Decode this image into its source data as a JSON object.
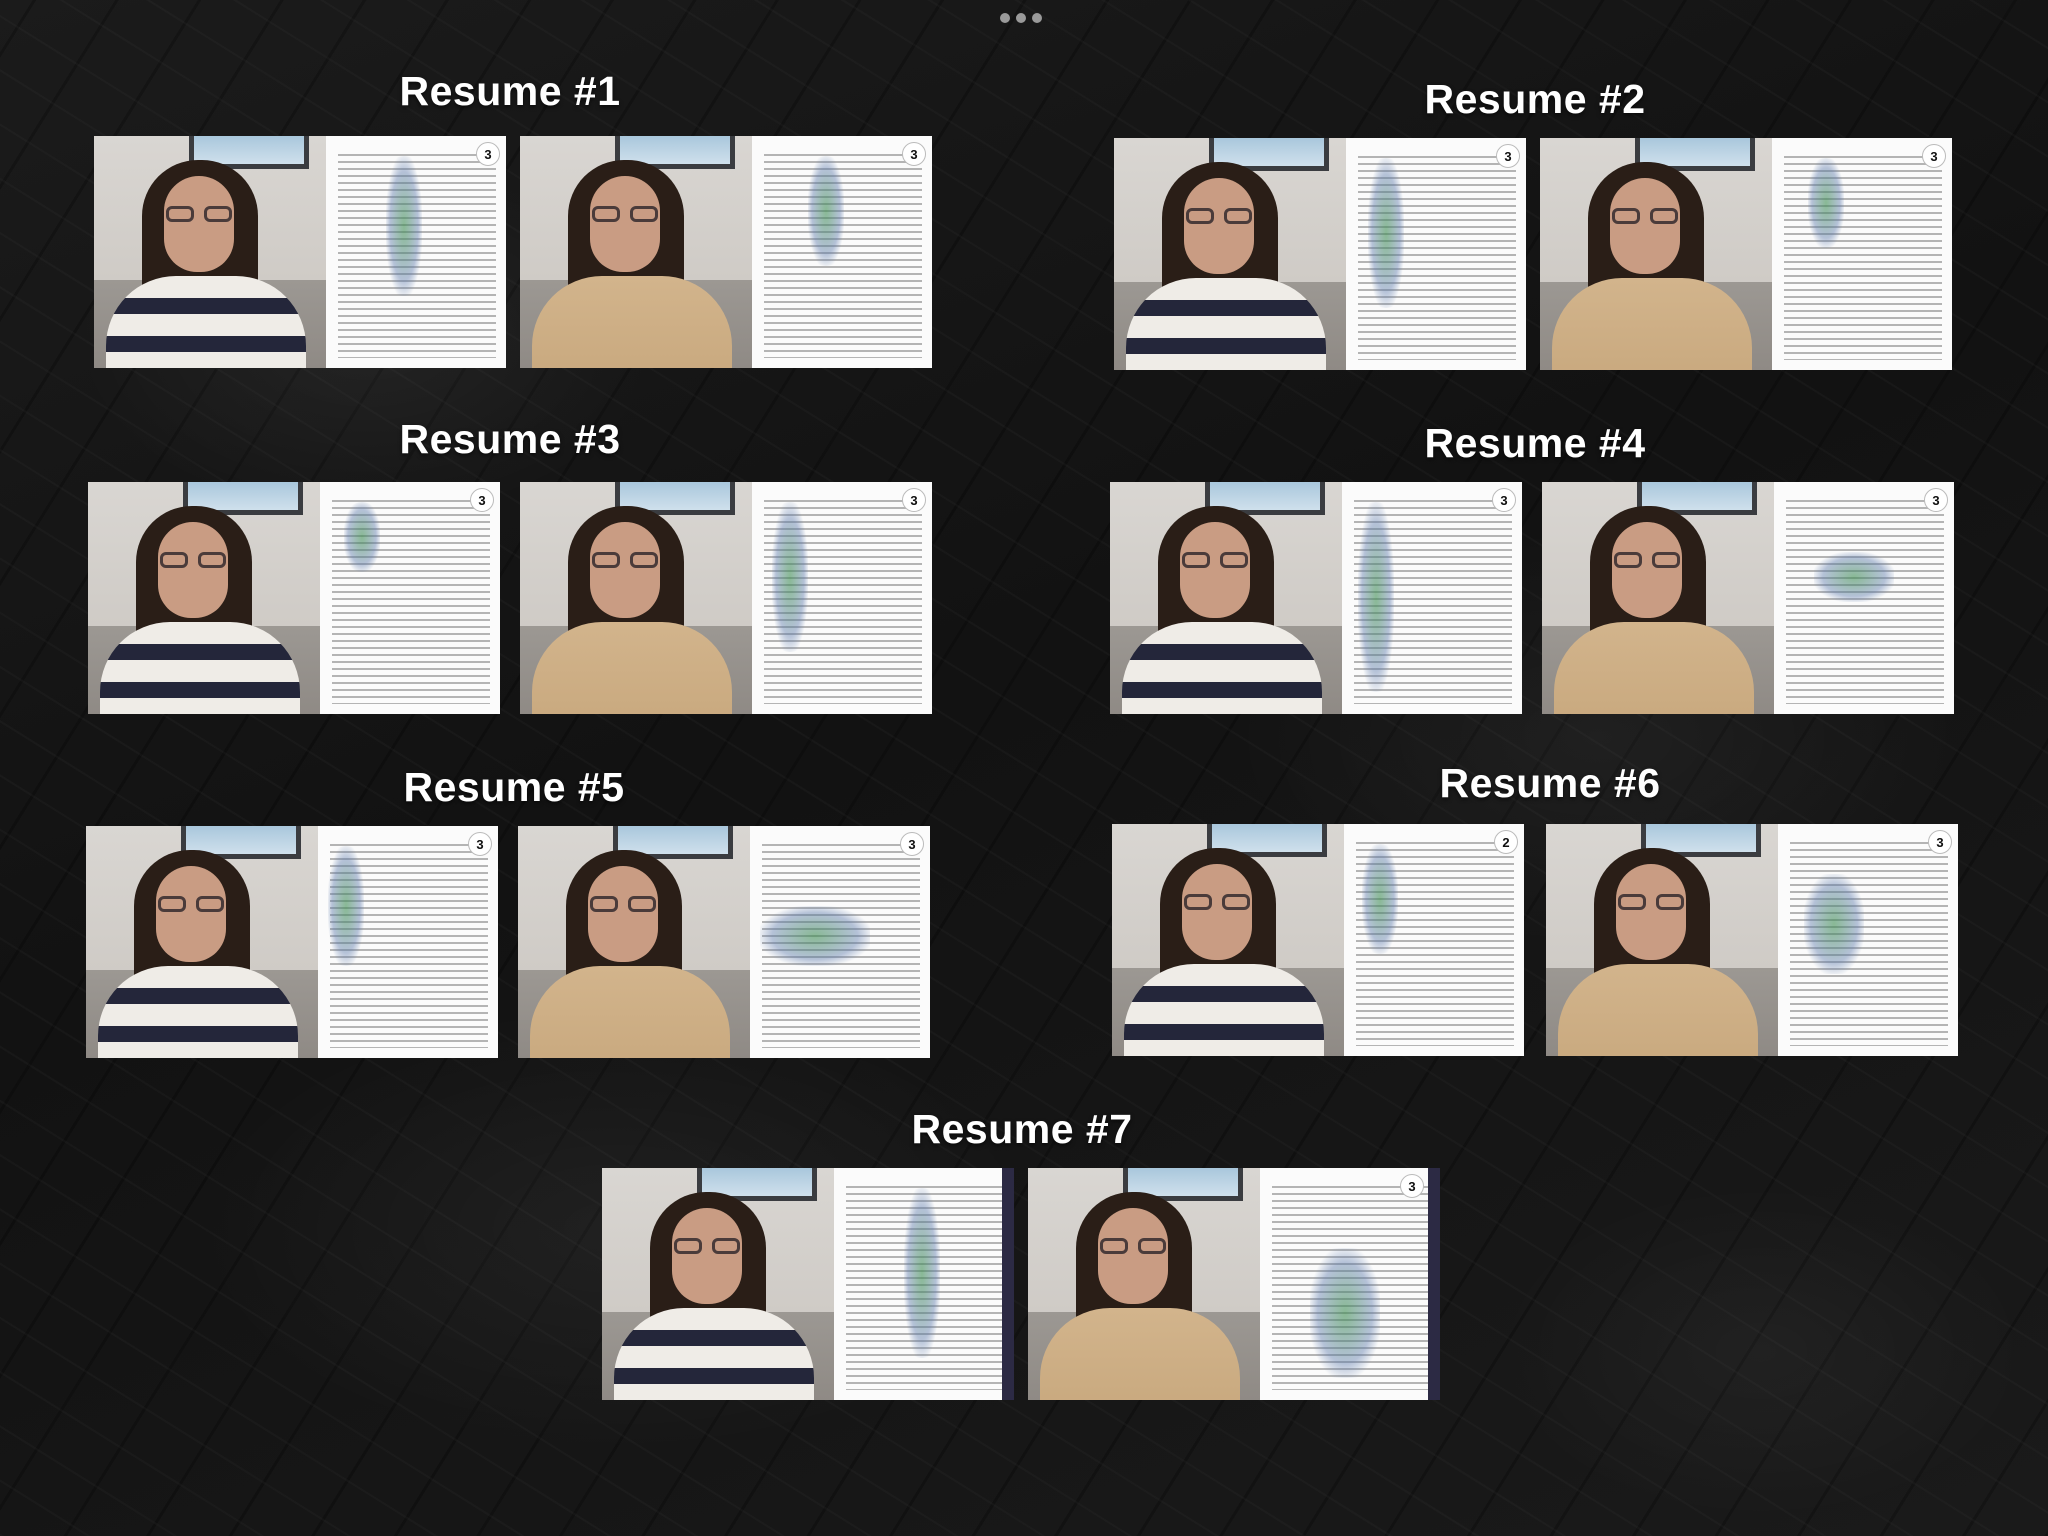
{
  "top_menu": {
    "icon": "more-dots-icon"
  },
  "sections": [
    {
      "title": "Resume #1",
      "badges": [
        "3",
        "3"
      ]
    },
    {
      "title": "Resume #2",
      "badges": [
        "3",
        "3"
      ]
    },
    {
      "title": "Resume #3",
      "badges": [
        "3",
        "3"
      ]
    },
    {
      "title": "Resume #4",
      "badges": [
        "3",
        "3"
      ]
    },
    {
      "title": "Resume #5",
      "badges": [
        "3",
        "3"
      ]
    },
    {
      "title": "Resume #6",
      "badges": [
        "2",
        "3"
      ]
    },
    {
      "title": "Resume #7",
      "badges": [
        "",
        "3"
      ]
    }
  ]
}
